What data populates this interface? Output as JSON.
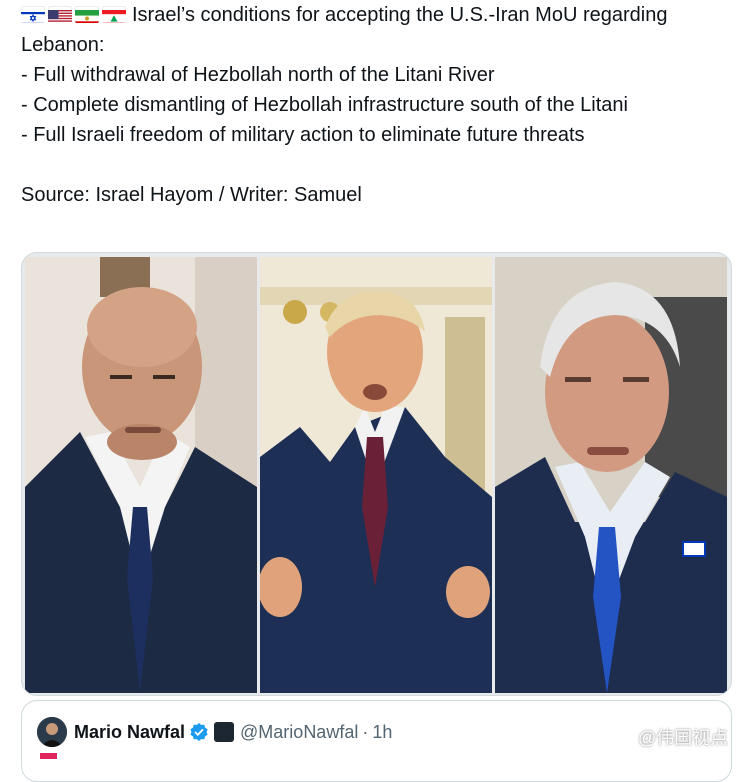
{
  "post": {
    "flags": [
      {
        "name": "israel-flag-icon"
      },
      {
        "name": "us-flag-icon"
      },
      {
        "name": "iran-flag-icon"
      },
      {
        "name": "lebanon-flag-icon"
      }
    ],
    "title_line1": "Israel’s conditions for accepting the U.S.-Iran MoU regarding",
    "title_line2": "Lebanon:",
    "bullets": [
      "- Full withdrawal of Hezbollah north of the Litani River",
      "- Complete dismantling of Hezbollah infrastructure south of the Litani",
      "- Full Israeli freedom of military action to eliminate future threats"
    ],
    "source": "Source: Israel Hayom / Writer: Samuel"
  },
  "media": {
    "photos": [
      {
        "name": "photo-left-official"
      },
      {
        "name": "photo-center-trump"
      },
      {
        "name": "photo-right-netanyahu"
      }
    ]
  },
  "quote": {
    "name": "Mario Nawfal",
    "handle": "@MarioNawfal",
    "separator": "·",
    "time": "1h",
    "verified_color": "#1d9bf0"
  },
  "watermark": {
    "text": "@伟国视点"
  },
  "colors": {
    "text": "#0f1419",
    "muted": "#536471",
    "border": "#cfd9de"
  }
}
